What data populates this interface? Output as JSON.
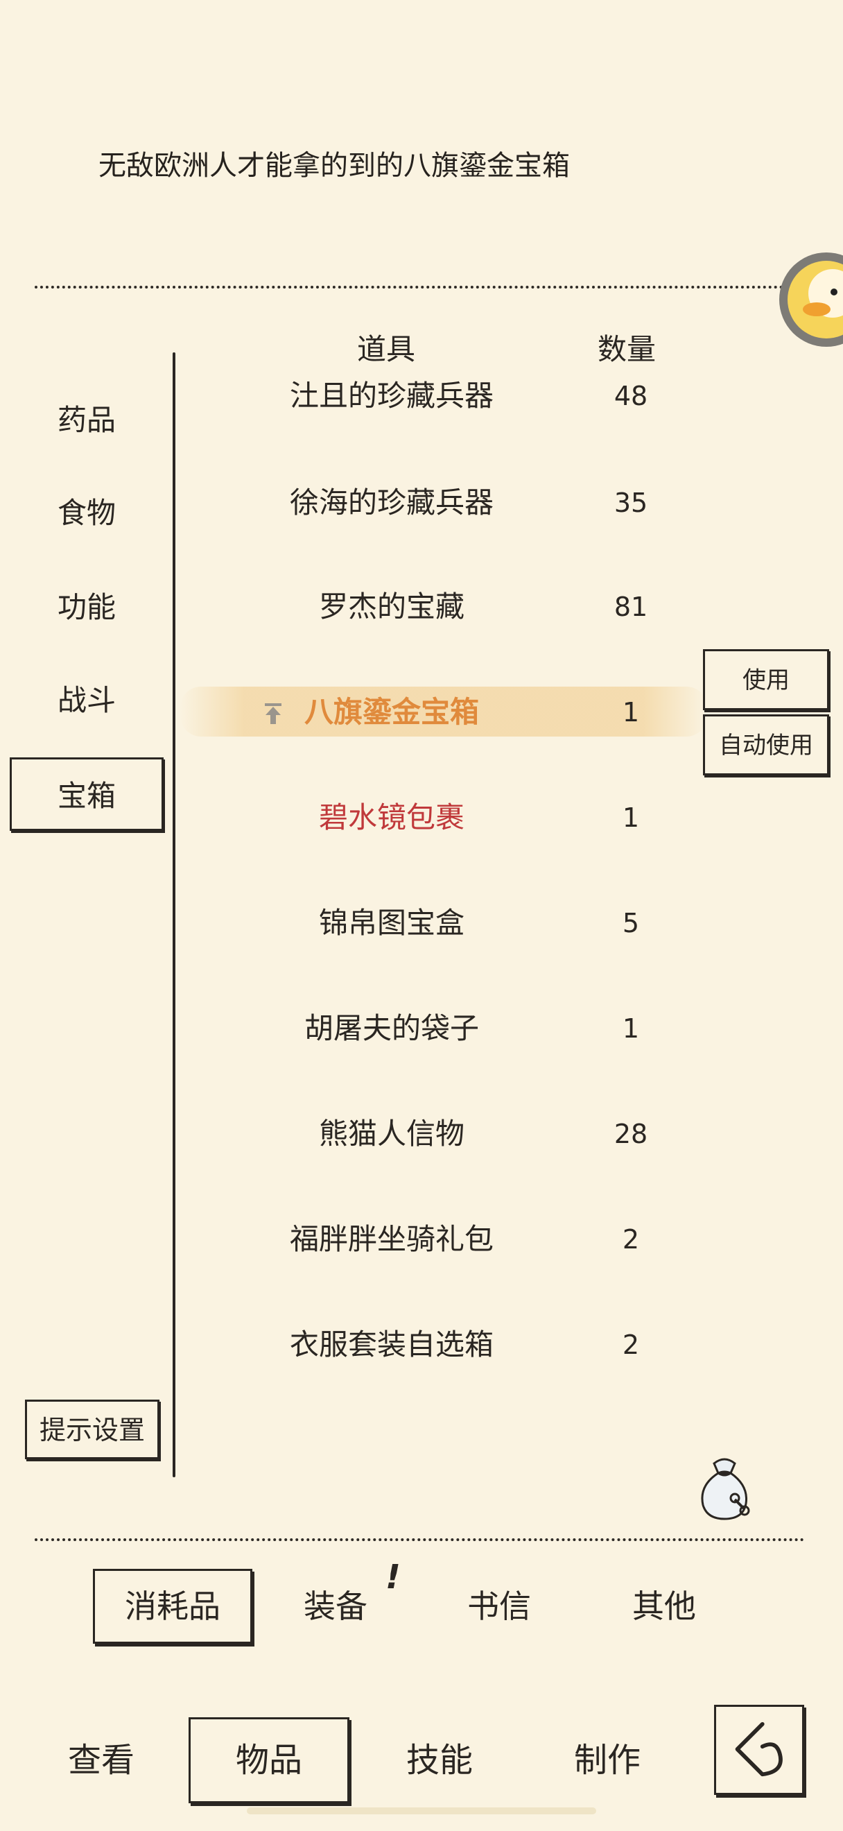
{
  "item_description": "无敌欧洲人才能拿的到的八旗鎏金宝箱",
  "table_headers": {
    "item": "道具",
    "quantity": "数量"
  },
  "categories": [
    {
      "label": "药品"
    },
    {
      "label": "食物"
    },
    {
      "label": "功能"
    },
    {
      "label": "战斗"
    },
    {
      "label": "宝箱",
      "selected": true
    }
  ],
  "hint_settings_label": "提示设置",
  "items": [
    {
      "name": "汢且的珍藏兵器",
      "qty": "48"
    },
    {
      "name": "徐海的珍藏兵器",
      "qty": "35"
    },
    {
      "name": "罗杰的宝藏",
      "qty": "81"
    },
    {
      "name": "八旗鎏金宝箱",
      "qty": "1",
      "selected": true,
      "color": "#e08a3c"
    },
    {
      "name": "碧水镜包裹",
      "qty": "1",
      "color": "#c0393b"
    },
    {
      "name": "锦帛图宝盒",
      "qty": "5"
    },
    {
      "name": "胡屠夫的袋子",
      "qty": "1"
    },
    {
      "name": "熊猫人信物",
      "qty": "28"
    },
    {
      "name": "福胖胖坐骑礼包",
      "qty": "2"
    },
    {
      "name": "衣服套装自选箱",
      "qty": "2"
    }
  ],
  "actions": {
    "use": "使用",
    "auto_use": "自动使用"
  },
  "sub_tabs": [
    {
      "label": "消耗品",
      "selected": true
    },
    {
      "label": "装备",
      "badge": "!"
    },
    {
      "label": "书信"
    },
    {
      "label": "其他"
    }
  ],
  "bottom_nav": [
    {
      "label": "查看"
    },
    {
      "label": "物品",
      "selected": true
    },
    {
      "label": "技能"
    },
    {
      "label": "制作"
    }
  ],
  "icons": {
    "avatar": "duck-avatar-icon",
    "bag": "item-bag-icon",
    "back": "back-arrow-icon",
    "sort": "up-arrow-icon"
  }
}
